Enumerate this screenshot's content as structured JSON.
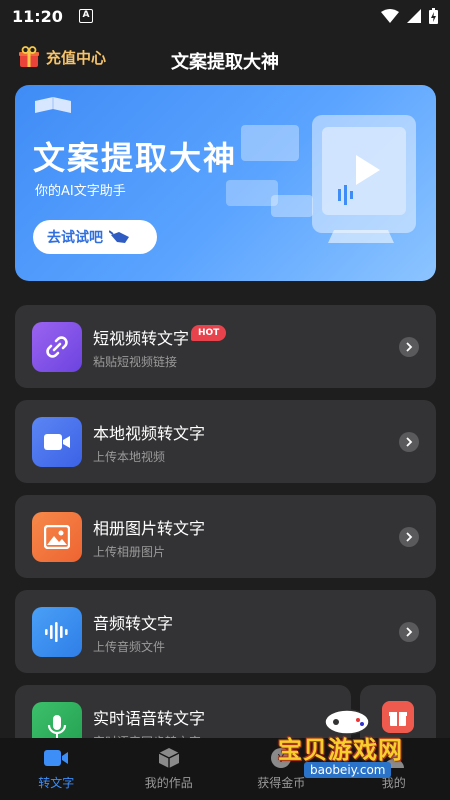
{
  "status_bar": {
    "time": "11:20",
    "notification_letter": "A"
  },
  "header": {
    "recharge_label": "充值中心",
    "title": "文案提取大神"
  },
  "banner": {
    "title": "文案提取大神",
    "subtitle": "你的AI文字助手",
    "button_label": "去试试吧"
  },
  "features": [
    {
      "title": "短视频转文字",
      "subtitle": "粘贴短视频链接",
      "badge": "HOT",
      "icon": "link-icon",
      "color": "#8a57e8"
    },
    {
      "title": "本地视频转文字",
      "subtitle": "上传本地视频",
      "icon": "video-camera-icon",
      "color": "#4a74ee"
    },
    {
      "title": "相册图片转文字",
      "subtitle": "上传相册图片",
      "icon": "image-icon",
      "color": "#f2773e"
    },
    {
      "title": "音频转文字",
      "subtitle": "上传音频文件",
      "icon": "audio-wave-icon",
      "color": "#3a8ff0"
    },
    {
      "title": "实时语音转文字",
      "subtitle": "实时语音同步转文字",
      "icon": "microphone-icon",
      "color": "#2fae5b"
    }
  ],
  "tabs": [
    {
      "label": "转文字",
      "icon": "video-tab-icon",
      "active": true
    },
    {
      "label": "我的作品",
      "icon": "box-icon",
      "active": false
    },
    {
      "label": "获得金币",
      "icon": "coin-icon",
      "active": false
    },
    {
      "label": "我的",
      "icon": "user-icon",
      "active": false
    }
  ],
  "watermark": {
    "main": "宝贝游戏网",
    "sub": "baobeiy.com"
  }
}
